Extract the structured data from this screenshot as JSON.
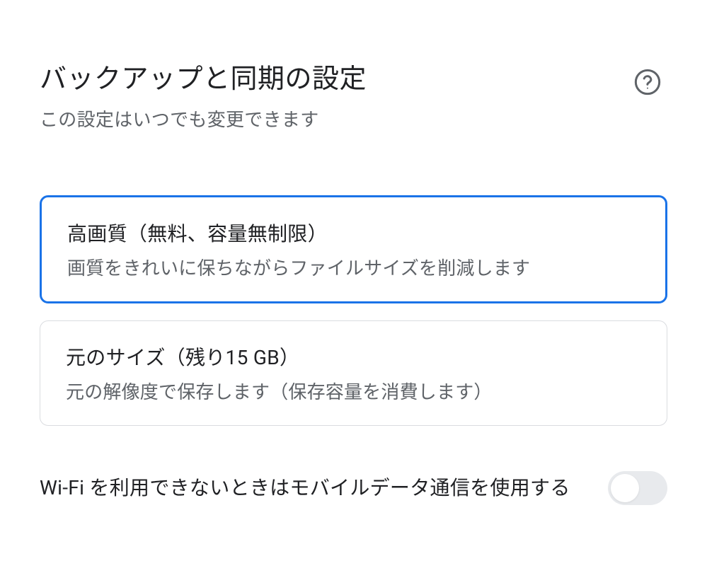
{
  "header": {
    "title": "バックアップと同期の設定",
    "subtitle": "この設定はいつでも変更できます"
  },
  "options": [
    {
      "title": "高画質（無料、容量無制限）",
      "description": "画質をきれいに保ちながらファイルサイズを削減します",
      "selected": true
    },
    {
      "title": "元のサイズ（残り15 GB）",
      "description": "元の解像度で保存します（保存容量を消費します）",
      "selected": false
    }
  ],
  "toggle": {
    "label": "Wi-Fi を利用できないときはモバイルデータ通信を使用する",
    "enabled": false
  }
}
